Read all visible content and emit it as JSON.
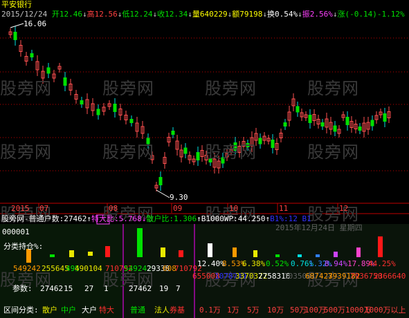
{
  "header": {
    "stock_name": "平安银行",
    "date": "2015/12/24",
    "open_label": "开",
    "open_value": "12.46",
    "high_label": "高",
    "high_value": "12.56",
    "low_label": "低",
    "low_value": "12.24",
    "close_label": "收",
    "close_value": "12.34",
    "volume_label": "量",
    "volume_value": "640229",
    "amount_label": "额",
    "amount_value": "79198",
    "turnover_label": "换",
    "turnover_value": "0.54%",
    "amplitude_label": "振",
    "amplitude_value": "2.56%",
    "change_label": "涨",
    "change_value": "(-0.14)",
    "change_pct": "-1.12%"
  },
  "price_markers": {
    "high": "16.06",
    "low": "9.30"
  },
  "x_axis": {
    "labels": [
      "2015",
      "07",
      "08",
      "09",
      "10",
      "11",
      "12"
    ]
  },
  "indicator": {
    "name": "股旁网-普通户数:",
    "count": "27462",
    "special_ratio_label": "特大比:5.768",
    "retail_ratio_label": "散户比:1.306",
    "wp_label": "B1000WP:44.250",
    "extra_label": "B1%:12",
    "extra2_label": "B1",
    "date_text": "2015年12月24日  星期四",
    "code": "000001",
    "category_label": "分类持仓%:",
    "params_label": "参数:",
    "section_label": "区间分类:"
  },
  "group1": {
    "values": [
      "549242",
      "255645",
      "495",
      "490104",
      "710792"
    ],
    "params": [
      "27462",
      "15",
      "27",
      "1"
    ],
    "categories": [
      "散户",
      "中户",
      "大户",
      "特大"
    ],
    "category_colors": [
      "#e8e800",
      "#00e800",
      "#ffffff",
      "#ff3030"
    ]
  },
  "group2": {
    "values": [
      "549242",
      "29338",
      "608",
      "710792"
    ],
    "params": [
      "27462",
      "19",
      "7"
    ],
    "categories": [
      "普通",
      "法人",
      "券基"
    ],
    "category_colors": [
      "#00e800",
      "#e8e800",
      "#ff3030"
    ]
  },
  "group3": {
    "pct_row": [
      "12.40%",
      "8.53%",
      "6.38%",
      "0.52%",
      "0.76%",
      "1.32%",
      "8.94%",
      "17.89%",
      "44.25%"
    ],
    "num_row": [
      "655008",
      "1078719",
      "3370372",
      "2758316",
      "1035001",
      "687423",
      "7939182",
      "7936750",
      "2366640"
    ],
    "categories": [
      "0.1万",
      "1万",
      "5万",
      "10万",
      "50万",
      "100万",
      "500万",
      "1000万",
      "1000万以上"
    ],
    "category_color": "#ff4040"
  },
  "watermark": "股旁网",
  "colors": {
    "up": "#ff5050",
    "down": "#00e0e0",
    "grid": "#c00000",
    "bar_green": "#00e000",
    "bar_red": "#ff1818",
    "bar_white": "#ffffff",
    "bar_orange": "#ff9900",
    "bar_yellow": "#e8e800",
    "bar_purple": "#cc44ff",
    "bar_blue": "#3030ff",
    "bar_pink": "#ff44cc",
    "sep_magenta": "#ff00ff"
  }
}
